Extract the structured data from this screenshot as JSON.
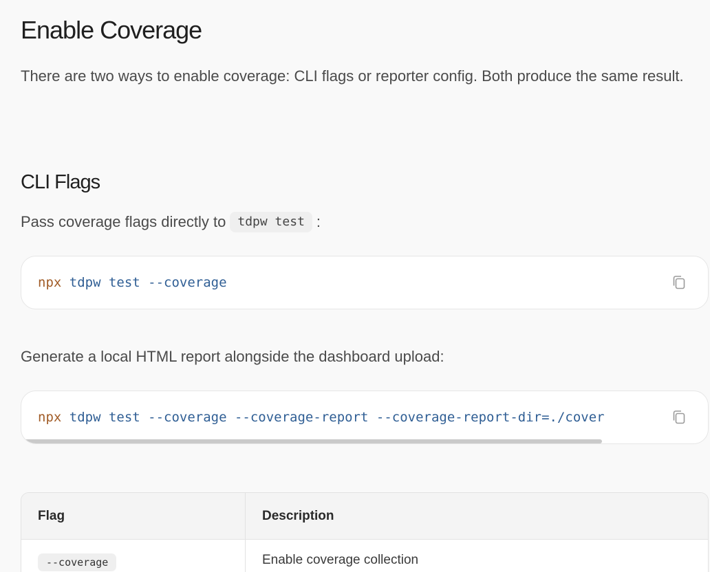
{
  "heading": "Enable Coverage",
  "intro": "There are two ways to enable coverage: CLI flags or reporter config. Both produce the same result.",
  "cli_section": {
    "heading": "CLI Flags",
    "para1_before": "Pass coverage flags directly to",
    "para1_code": "tdpw test",
    "para1_after": ":",
    "code1": {
      "cmd": "npx",
      "args": " tdpw test --coverage",
      "copy_icon": "copy-icon"
    },
    "para2": "Generate a local HTML report alongside the dashboard upload:",
    "code2": {
      "cmd": "npx",
      "args": " tdpw test --coverage --coverage-report --coverage-report-dir=./cover",
      "copy_icon": "copy-icon"
    }
  },
  "table": {
    "headers": {
      "flag": "Flag",
      "description": "Description"
    },
    "rows": [
      {
        "flag": "--coverage",
        "description": "Enable coverage collection"
      }
    ]
  },
  "colors": {
    "background": "#f9f9f9",
    "code_command": "#a15c27",
    "code_args": "#2f5e94"
  }
}
